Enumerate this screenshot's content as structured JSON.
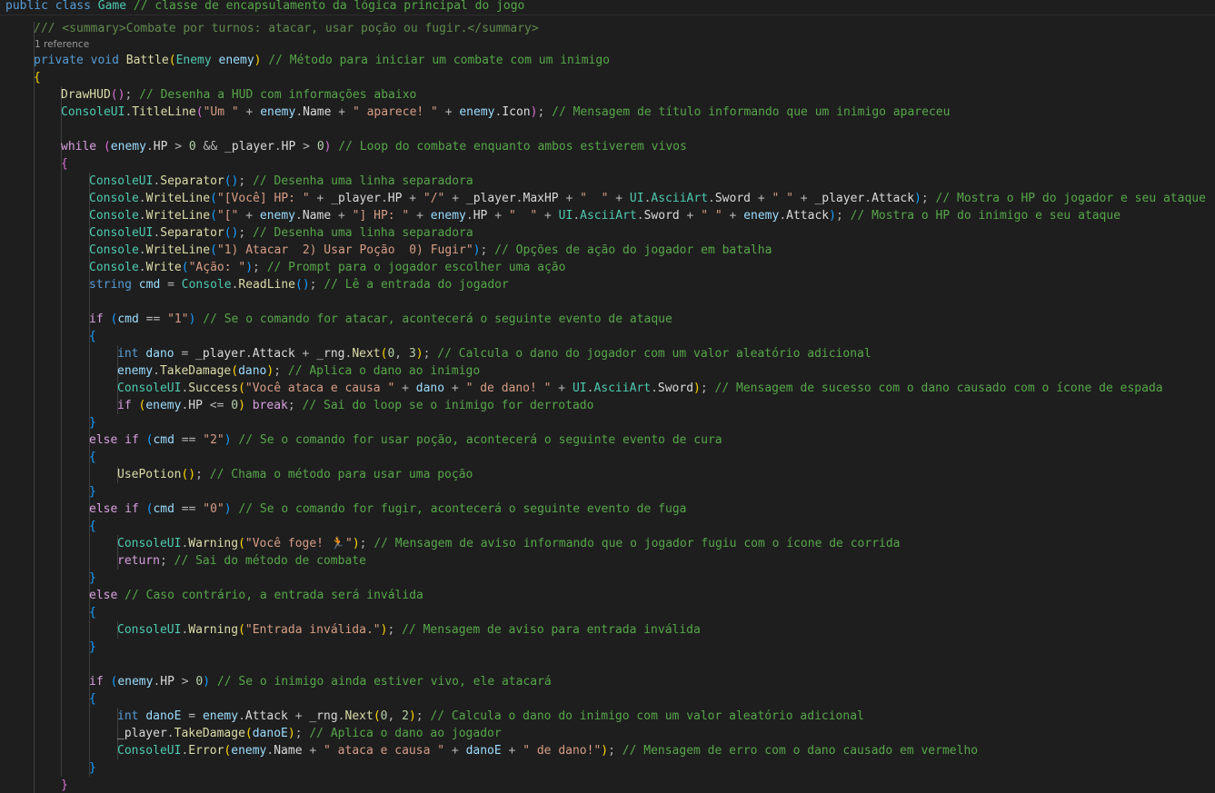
{
  "editor": {
    "language": "csharp",
    "code_lens": "1 reference",
    "emoji_runner": "🏃",
    "lines": [
      [
        [
          "public class ",
          "kw"
        ],
        [
          "Game",
          "cls"
        ],
        [
          " // classe de encapsulamento da lógica principal do jogo",
          "cm"
        ]
      ],
      [
        [
          "/// <summary>Combate por turnos: atacar, usar poção ou fugir.</summary>",
          "doc"
        ]
      ],
      [
        [
          "private ",
          "kw"
        ],
        [
          "void ",
          "kw"
        ],
        [
          "Battle",
          "fn"
        ],
        [
          "(",
          "br1"
        ],
        [
          "Enemy ",
          "cls"
        ],
        [
          "enemy",
          "var"
        ],
        [
          ")",
          "br1"
        ],
        [
          " // Método para iniciar um combate com um inimigo",
          "cm"
        ]
      ],
      [
        [
          "{",
          "br1"
        ]
      ],
      [
        [
          "DrawHUD",
          "fn"
        ],
        [
          "()",
          "br2"
        ],
        [
          "; ",
          "p"
        ],
        [
          "// Desenha a HUD com informações abaixo",
          "cm"
        ]
      ],
      [
        [
          "ConsoleUI",
          "cls"
        ],
        [
          ".",
          "p"
        ],
        [
          "TitleLine",
          "fn"
        ],
        [
          "(",
          "br2"
        ],
        [
          "\"Um \"",
          "str"
        ],
        [
          " + ",
          "op"
        ],
        [
          "enemy",
          "var"
        ],
        [
          ".",
          "p"
        ],
        [
          "Name",
          "fld"
        ],
        [
          " + ",
          "op"
        ],
        [
          "\" aparece! \"",
          "str"
        ],
        [
          " + ",
          "op"
        ],
        [
          "enemy",
          "var"
        ],
        [
          ".",
          "p"
        ],
        [
          "Icon",
          "fld"
        ],
        [
          ")",
          "br2"
        ],
        [
          "; ",
          "p"
        ],
        [
          "// Mensagem de título informando que um inimigo apareceu",
          "cm"
        ]
      ],
      [],
      [
        [
          "while ",
          "ctl"
        ],
        [
          "(",
          "br2"
        ],
        [
          "enemy",
          "var"
        ],
        [
          ".",
          "p"
        ],
        [
          "HP",
          "fld"
        ],
        [
          " > ",
          "op"
        ],
        [
          "0",
          "num"
        ],
        [
          " && ",
          "op"
        ],
        [
          "_player",
          "fld"
        ],
        [
          ".",
          "p"
        ],
        [
          "HP",
          "fld"
        ],
        [
          " > ",
          "op"
        ],
        [
          "0",
          "num"
        ],
        [
          ")",
          "br2"
        ],
        [
          " // Loop do combate enquanto ambos estiverem vivos",
          "cm"
        ]
      ],
      [
        [
          "{",
          "br2"
        ]
      ],
      [
        [
          "ConsoleUI",
          "cls"
        ],
        [
          ".",
          "p"
        ],
        [
          "Separator",
          "fn"
        ],
        [
          "()",
          "br3"
        ],
        [
          "; ",
          "p"
        ],
        [
          "// Desenha uma linha separadora",
          "cm"
        ]
      ],
      [
        [
          "Console",
          "cls"
        ],
        [
          ".",
          "p"
        ],
        [
          "WriteLine",
          "fn"
        ],
        [
          "(",
          "br3"
        ],
        [
          "\"[Você] HP: \"",
          "str"
        ],
        [
          " + ",
          "op"
        ],
        [
          "_player",
          "fld"
        ],
        [
          ".",
          "p"
        ],
        [
          "HP",
          "fld"
        ],
        [
          " + ",
          "op"
        ],
        [
          "\"/\"",
          "str"
        ],
        [
          " + ",
          "op"
        ],
        [
          "_player",
          "fld"
        ],
        [
          ".",
          "p"
        ],
        [
          "MaxHP",
          "fld"
        ],
        [
          " + ",
          "op"
        ],
        [
          "\"  \"",
          "str"
        ],
        [
          " + ",
          "op"
        ],
        [
          "UI",
          "cls"
        ],
        [
          ".",
          "p"
        ],
        [
          "AsciiArt",
          "cls"
        ],
        [
          ".",
          "p"
        ],
        [
          "Sword",
          "fld"
        ],
        [
          " + ",
          "op"
        ],
        [
          "\" \"",
          "str"
        ],
        [
          " + ",
          "op"
        ],
        [
          "_player",
          "fld"
        ],
        [
          ".",
          "p"
        ],
        [
          "Attack",
          "fld"
        ],
        [
          ")",
          "br3"
        ],
        [
          "; ",
          "p"
        ],
        [
          "// Mostra o HP do jogador e seu ataque",
          "cm"
        ]
      ],
      [
        [
          "Console",
          "cls"
        ],
        [
          ".",
          "p"
        ],
        [
          "WriteLine",
          "fn"
        ],
        [
          "(",
          "br3"
        ],
        [
          "\"[\"",
          "str"
        ],
        [
          " + ",
          "op"
        ],
        [
          "enemy",
          "var"
        ],
        [
          ".",
          "p"
        ],
        [
          "Name",
          "fld"
        ],
        [
          " + ",
          "op"
        ],
        [
          "\"] HP: \"",
          "str"
        ],
        [
          " + ",
          "op"
        ],
        [
          "enemy",
          "var"
        ],
        [
          ".",
          "p"
        ],
        [
          "HP",
          "fld"
        ],
        [
          " + ",
          "op"
        ],
        [
          "\"  \"",
          "str"
        ],
        [
          " + ",
          "op"
        ],
        [
          "UI",
          "cls"
        ],
        [
          ".",
          "p"
        ],
        [
          "AsciiArt",
          "cls"
        ],
        [
          ".",
          "p"
        ],
        [
          "Sword",
          "fld"
        ],
        [
          " + ",
          "op"
        ],
        [
          "\" \"",
          "str"
        ],
        [
          " + ",
          "op"
        ],
        [
          "enemy",
          "var"
        ],
        [
          ".",
          "p"
        ],
        [
          "Attack",
          "fld"
        ],
        [
          ")",
          "br3"
        ],
        [
          "; ",
          "p"
        ],
        [
          "// Mostra o HP do inimigo e seu ataque",
          "cm"
        ]
      ],
      [
        [
          "ConsoleUI",
          "cls"
        ],
        [
          ".",
          "p"
        ],
        [
          "Separator",
          "fn"
        ],
        [
          "()",
          "br3"
        ],
        [
          "; ",
          "p"
        ],
        [
          "// Desenha uma linha separadora",
          "cm"
        ]
      ],
      [
        [
          "Console",
          "cls"
        ],
        [
          ".",
          "p"
        ],
        [
          "WriteLine",
          "fn"
        ],
        [
          "(",
          "br3"
        ],
        [
          "\"1) Atacar  2) Usar Poção  0) Fugir\"",
          "str"
        ],
        [
          ")",
          "br3"
        ],
        [
          "; ",
          "p"
        ],
        [
          "// Opções de ação do jogador em batalha",
          "cm"
        ]
      ],
      [
        [
          "Console",
          "cls"
        ],
        [
          ".",
          "p"
        ],
        [
          "Write",
          "fn"
        ],
        [
          "(",
          "br3"
        ],
        [
          "\"Ação: \"",
          "str"
        ],
        [
          ")",
          "br3"
        ],
        [
          "; ",
          "p"
        ],
        [
          "// Prompt para o jogador escolher uma ação",
          "cm"
        ]
      ],
      [
        [
          "string ",
          "kw"
        ],
        [
          "cmd",
          "var"
        ],
        [
          " = ",
          "op"
        ],
        [
          "Console",
          "cls"
        ],
        [
          ".",
          "p"
        ],
        [
          "ReadLine",
          "fn"
        ],
        [
          "()",
          "br3"
        ],
        [
          "; ",
          "p"
        ],
        [
          "// Lê a entrada do jogador",
          "cm"
        ]
      ],
      [],
      [
        [
          "if ",
          "ctl"
        ],
        [
          "(",
          "br3"
        ],
        [
          "cmd",
          "var"
        ],
        [
          " == ",
          "op"
        ],
        [
          "\"1\"",
          "str"
        ],
        [
          ")",
          "br3"
        ],
        [
          " // Se o comando for atacar, acontecerá o seguinte evento de ataque",
          "cm"
        ]
      ],
      [
        [
          "{",
          "br3"
        ]
      ],
      [
        [
          "int ",
          "kw"
        ],
        [
          "dano",
          "var"
        ],
        [
          " = ",
          "op"
        ],
        [
          "_player",
          "fld"
        ],
        [
          ".",
          "p"
        ],
        [
          "Attack",
          "fld"
        ],
        [
          " + ",
          "op"
        ],
        [
          "_rng",
          "fld"
        ],
        [
          ".",
          "p"
        ],
        [
          "Next",
          "fn"
        ],
        [
          "(",
          "br1"
        ],
        [
          "0",
          "num"
        ],
        [
          ", ",
          "p"
        ],
        [
          "3",
          "num"
        ],
        [
          ")",
          "br1"
        ],
        [
          "; ",
          "p"
        ],
        [
          "// Calcula o dano do jogador com um valor aleatório adicional",
          "cm"
        ]
      ],
      [
        [
          "enemy",
          "var"
        ],
        [
          ".",
          "p"
        ],
        [
          "TakeDamage",
          "fn"
        ],
        [
          "(",
          "br1"
        ],
        [
          "dano",
          "var"
        ],
        [
          ")",
          "br1"
        ],
        [
          "; ",
          "p"
        ],
        [
          "// Aplica o dano ao inimigo",
          "cm"
        ]
      ],
      [
        [
          "ConsoleUI",
          "cls"
        ],
        [
          ".",
          "p"
        ],
        [
          "Success",
          "fn"
        ],
        [
          "(",
          "br1"
        ],
        [
          "\"Você ataca e causa \"",
          "str"
        ],
        [
          " + ",
          "op"
        ],
        [
          "dano",
          "var"
        ],
        [
          " + ",
          "op"
        ],
        [
          "\" de dano! \"",
          "str"
        ],
        [
          " + ",
          "op"
        ],
        [
          "UI",
          "cls"
        ],
        [
          ".",
          "p"
        ],
        [
          "AsciiArt",
          "cls"
        ],
        [
          ".",
          "p"
        ],
        [
          "Sword",
          "fld"
        ],
        [
          ")",
          "br1"
        ],
        [
          "; ",
          "p"
        ],
        [
          "// Mensagem de sucesso com o dano causado com o ícone de espada",
          "cm"
        ]
      ],
      [
        [
          "if ",
          "ctl"
        ],
        [
          "(",
          "br1"
        ],
        [
          "enemy",
          "var"
        ],
        [
          ".",
          "p"
        ],
        [
          "HP",
          "fld"
        ],
        [
          " <= ",
          "op"
        ],
        [
          "0",
          "num"
        ],
        [
          ") ",
          "br1"
        ],
        [
          "break",
          "ctl"
        ],
        [
          "; ",
          "p"
        ],
        [
          "// Sai do loop se o inimigo for derrotado",
          "cm"
        ]
      ],
      [
        [
          "}",
          "br3"
        ]
      ],
      [
        [
          "else ",
          "ctl"
        ],
        [
          "if ",
          "ctl"
        ],
        [
          "(",
          "br3"
        ],
        [
          "cmd",
          "var"
        ],
        [
          " == ",
          "op"
        ],
        [
          "\"2\"",
          "str"
        ],
        [
          ")",
          "br3"
        ],
        [
          " // Se o comando for usar poção, acontecerá o seguinte evento de cura",
          "cm"
        ]
      ],
      [
        [
          "{",
          "br3"
        ]
      ],
      [
        [
          "UsePotion",
          "fn"
        ],
        [
          "()",
          "br1"
        ],
        [
          "; ",
          "p"
        ],
        [
          "// Chama o método para usar uma poção",
          "cm"
        ]
      ],
      [
        [
          "}",
          "br3"
        ]
      ],
      [
        [
          "else ",
          "ctl"
        ],
        [
          "if ",
          "ctl"
        ],
        [
          "(",
          "br3"
        ],
        [
          "cmd",
          "var"
        ],
        [
          " == ",
          "op"
        ],
        [
          "\"0\"",
          "str"
        ],
        [
          ")",
          "br3"
        ],
        [
          " // Se o comando for fugir, acontecerá o seguinte evento de fuga",
          "cm"
        ]
      ],
      [
        [
          "{",
          "br3"
        ]
      ],
      [
        [
          "ConsoleUI",
          "cls"
        ],
        [
          ".",
          "p"
        ],
        [
          "Warning",
          "fn"
        ],
        [
          "(",
          "br1"
        ],
        [
          "\"Você foge! 🏃\"",
          "str"
        ],
        [
          ")",
          "br1"
        ],
        [
          "; ",
          "p"
        ],
        [
          "// Mensagem de aviso informando que o jogador fugiu com o ícone de corrida",
          "cm"
        ]
      ],
      [
        [
          "return",
          "ctl"
        ],
        [
          "; ",
          "p"
        ],
        [
          "// Sai do método de combate",
          "cm"
        ]
      ],
      [
        [
          "}",
          "br3"
        ]
      ],
      [
        [
          "else ",
          "ctl"
        ],
        [
          "// Caso contrário, a entrada será inválida",
          "cm"
        ]
      ],
      [
        [
          "{",
          "br3"
        ]
      ],
      [
        [
          "ConsoleUI",
          "cls"
        ],
        [
          ".",
          "p"
        ],
        [
          "Warning",
          "fn"
        ],
        [
          "(",
          "br1"
        ],
        [
          "\"Entrada inválida.\"",
          "str"
        ],
        [
          ")",
          "br1"
        ],
        [
          "; ",
          "p"
        ],
        [
          "// Mensagem de aviso para entrada inválida",
          "cm"
        ]
      ],
      [
        [
          "}",
          "br3"
        ]
      ],
      [],
      [
        [
          "if ",
          "ctl"
        ],
        [
          "(",
          "br3"
        ],
        [
          "enemy",
          "var"
        ],
        [
          ".",
          "p"
        ],
        [
          "HP",
          "fld"
        ],
        [
          " > ",
          "op"
        ],
        [
          "0",
          "num"
        ],
        [
          ")",
          "br3"
        ],
        [
          " // Se o inimigo ainda estiver vivo, ele atacará",
          "cm"
        ]
      ],
      [
        [
          "{",
          "br3"
        ]
      ],
      [
        [
          "int ",
          "kw"
        ],
        [
          "danoE",
          "var"
        ],
        [
          " = ",
          "op"
        ],
        [
          "enemy",
          "var"
        ],
        [
          ".",
          "p"
        ],
        [
          "Attack",
          "fld"
        ],
        [
          " + ",
          "op"
        ],
        [
          "_rng",
          "fld"
        ],
        [
          ".",
          "p"
        ],
        [
          "Next",
          "fn"
        ],
        [
          "(",
          "br1"
        ],
        [
          "0",
          "num"
        ],
        [
          ", ",
          "p"
        ],
        [
          "2",
          "num"
        ],
        [
          ")",
          "br1"
        ],
        [
          "; ",
          "p"
        ],
        [
          "// Calcula o dano do inimigo com um valor aleatório adicional",
          "cm"
        ]
      ],
      [
        [
          "_player",
          "fld"
        ],
        [
          ".",
          "p"
        ],
        [
          "TakeDamage",
          "fn"
        ],
        [
          "(",
          "br1"
        ],
        [
          "danoE",
          "var"
        ],
        [
          ")",
          "br1"
        ],
        [
          "; ",
          "p"
        ],
        [
          "// Aplica o dano ao jogador",
          "cm"
        ]
      ],
      [
        [
          "ConsoleUI",
          "cls"
        ],
        [
          ".",
          "p"
        ],
        [
          "Error",
          "fn"
        ],
        [
          "(",
          "br1"
        ],
        [
          "enemy",
          "var"
        ],
        [
          ".",
          "p"
        ],
        [
          "Name",
          "fld"
        ],
        [
          " + ",
          "op"
        ],
        [
          "\" ataca e causa \"",
          "str"
        ],
        [
          " + ",
          "op"
        ],
        [
          "danoE",
          "var"
        ],
        [
          " + ",
          "op"
        ],
        [
          "\" de dano!\"",
          "str"
        ],
        [
          ")",
          "br1"
        ],
        [
          "; ",
          "p"
        ],
        [
          "// Mensagem de erro com o dano causado em vermelho",
          "cm"
        ]
      ],
      [
        [
          "}",
          "br3"
        ]
      ],
      [
        [
          "}",
          "br2"
        ]
      ]
    ]
  }
}
